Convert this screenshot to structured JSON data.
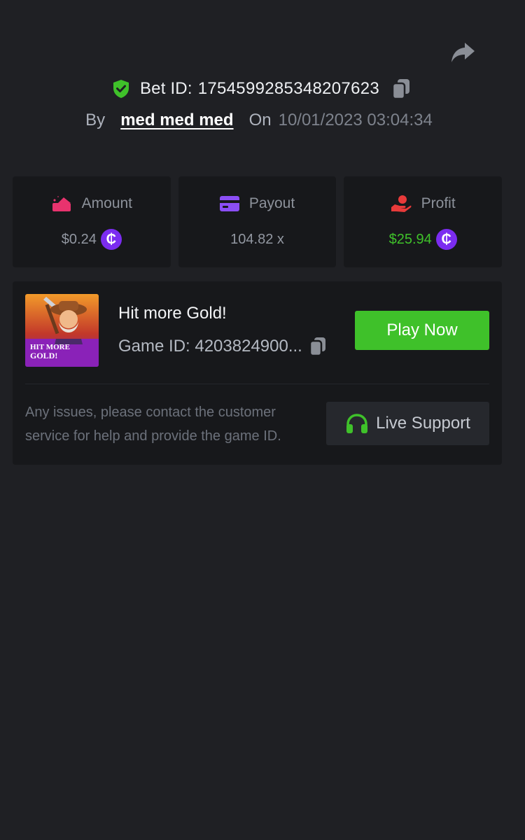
{
  "header": {
    "bet_label": "Bet ID:",
    "bet_id": "1754599285348207623",
    "by_label": "By",
    "username": "med med med",
    "on_label": "On",
    "datetime": "10/01/2023 03:04:34"
  },
  "stats": [
    {
      "title": "Amount",
      "value": "$0.24",
      "icon": "money-icon",
      "has_coin": true
    },
    {
      "title": "Payout",
      "value": "104.82 x",
      "icon": "card-icon",
      "has_coin": false
    },
    {
      "title": "Profit",
      "value": "$25.94",
      "icon": "hand-coin-icon",
      "has_coin": true
    }
  ],
  "coin_symbol": "₵",
  "game": {
    "title": "Hit more Gold!",
    "id_text": "Game ID: 4203824900...",
    "thumb_text_line1": "HIT MORE",
    "thumb_text_line2": "GOLD!",
    "play_label": "Play Now"
  },
  "support": {
    "help_text": "Any issues, please contact the customer service for help and provide the game ID.",
    "button_label": "Live Support"
  },
  "colors": {
    "background": "#1f2024",
    "panel": "#17181b",
    "accent_green": "#3fc12a",
    "coin_purple": "#7b2cf0",
    "amount_pink": "#e8336e",
    "payout_purple": "#8b4ef5",
    "profit_red": "#e83a3a"
  }
}
